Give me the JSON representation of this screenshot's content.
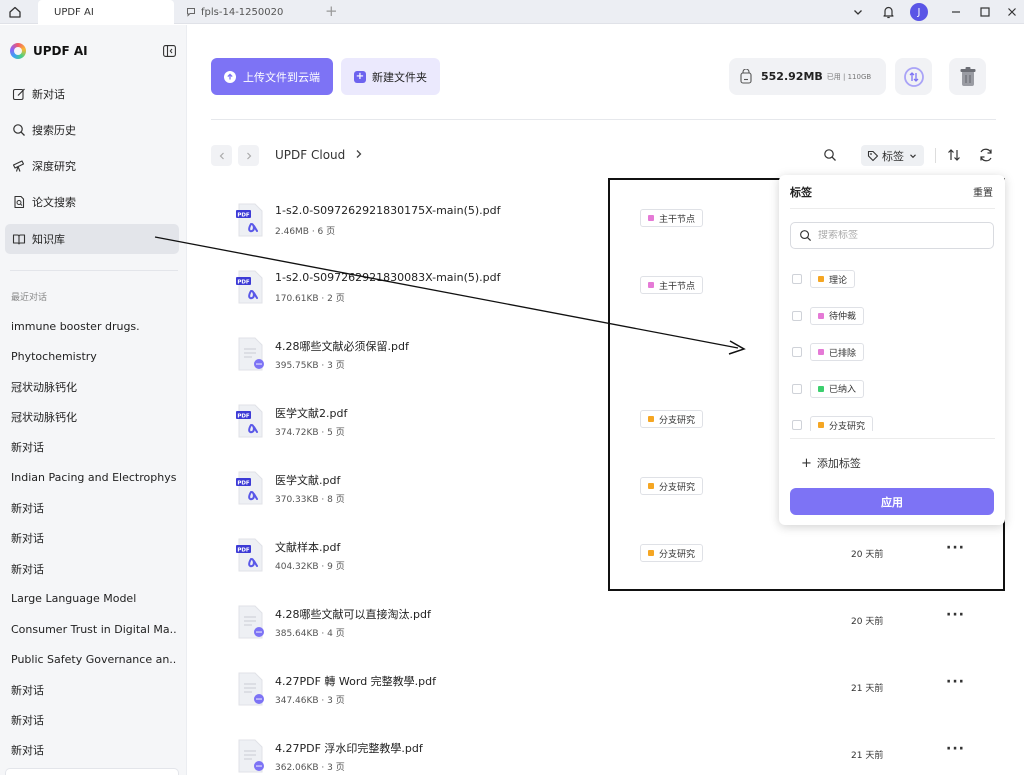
{
  "tabs": [
    {
      "label": "UPDF AI",
      "active": true
    },
    {
      "label": "fpls-14-1250020",
      "active": false
    }
  ],
  "user": {
    "initial": "J"
  },
  "sidebar": {
    "brand": "UPDF AI",
    "items": [
      {
        "label": "新对话",
        "icon": "edit-icon"
      },
      {
        "label": "搜索历史",
        "icon": "search-icon"
      },
      {
        "label": "深度研究",
        "icon": "telescope-icon"
      },
      {
        "label": "论文搜索",
        "icon": "doc-search-icon"
      },
      {
        "label": "知识库",
        "icon": "book-icon",
        "active": true
      }
    ],
    "recent_label": "最近对话",
    "recent": [
      "immune booster drugs.",
      "Phytochemistry",
      "冠状动脉钙化",
      "冠状动脉钙化",
      "新对话",
      "Indian Pacing and Electrophysiology...",
      "新对话",
      "新对话",
      "新对话",
      "Large Language Model",
      "Consumer Trust in Digital Ma...",
      "Public Safety Governance an...",
      "新对话",
      "新对话",
      "新对话"
    ]
  },
  "toolbar": {
    "upload_label": "上传文件到云端",
    "new_folder_label": "新建文件夹",
    "storage_used": "552.92MB",
    "storage_meta": "已用 | 110GB"
  },
  "breadcrumb": {
    "root": "UPDF Cloud"
  },
  "filter": {
    "tag_label": "标签"
  },
  "files": [
    {
      "name": "1-s2.0-S097262921830175X-main(5).pdf",
      "meta": "2.46MB · 6 页",
      "type": "pdf",
      "tag": "主干节点",
      "tag_color": "#e57ad6",
      "time": ""
    },
    {
      "name": "1-s2.0-S097262921830083X-main(5).pdf",
      "meta": "170.61KB · 2 页",
      "type": "pdf",
      "tag": "主干节点",
      "tag_color": "#e57ad6",
      "time": ""
    },
    {
      "name": "4.28哪些文献必须保留.pdf",
      "meta": "395.75KB · 3 页",
      "type": "doc",
      "tag": "",
      "tag_color": "",
      "time": ""
    },
    {
      "name": "医学文献2.pdf",
      "meta": "374.72KB · 5 页",
      "type": "pdf",
      "tag": "分支研究",
      "tag_color": "#f5a623",
      "time": ""
    },
    {
      "name": "医学文献.pdf",
      "meta": "370.33KB · 8 页",
      "type": "pdf",
      "tag": "分支研究",
      "tag_color": "#f5a623",
      "time": ""
    },
    {
      "name": "文献样本.pdf",
      "meta": "404.32KB · 9 页",
      "type": "pdf",
      "tag": "分支研究",
      "tag_color": "#f5a623",
      "time": "20 天前"
    },
    {
      "name": "4.28哪些文献可以直接淘汰.pdf",
      "meta": "385.64KB · 4 页",
      "type": "doc",
      "tag": "",
      "tag_color": "",
      "time": "20 天前"
    },
    {
      "name": "4.27PDF 轉 Word 完整教學.pdf",
      "meta": "347.46KB · 3 页",
      "type": "doc",
      "tag": "",
      "tag_color": "",
      "time": "21 天前"
    },
    {
      "name": "4.27PDF 浮水印完整教學.pdf",
      "meta": "362.06KB · 3 页",
      "type": "doc",
      "tag": "",
      "tag_color": "",
      "time": "21 天前"
    }
  ],
  "tag_panel": {
    "title": "标签",
    "reset": "重置",
    "search_placeholder": "搜索标签",
    "tags": [
      {
        "label": "理论",
        "color": "#f5a623"
      },
      {
        "label": "待仲裁",
        "color": "#e57ad6"
      },
      {
        "label": "已排除",
        "color": "#e57ad6"
      },
      {
        "label": "已纳入",
        "color": "#3ccf6e"
      },
      {
        "label": "分支研究",
        "color": "#f5a623"
      }
    ],
    "add_label": "添加标签",
    "apply_label": "应用"
  },
  "colors": {
    "accent": "#7d73f5",
    "accent_light": "#ebe9fd",
    "pink": "#e57ad6",
    "orange": "#f5a623",
    "green": "#3ccf6e"
  }
}
